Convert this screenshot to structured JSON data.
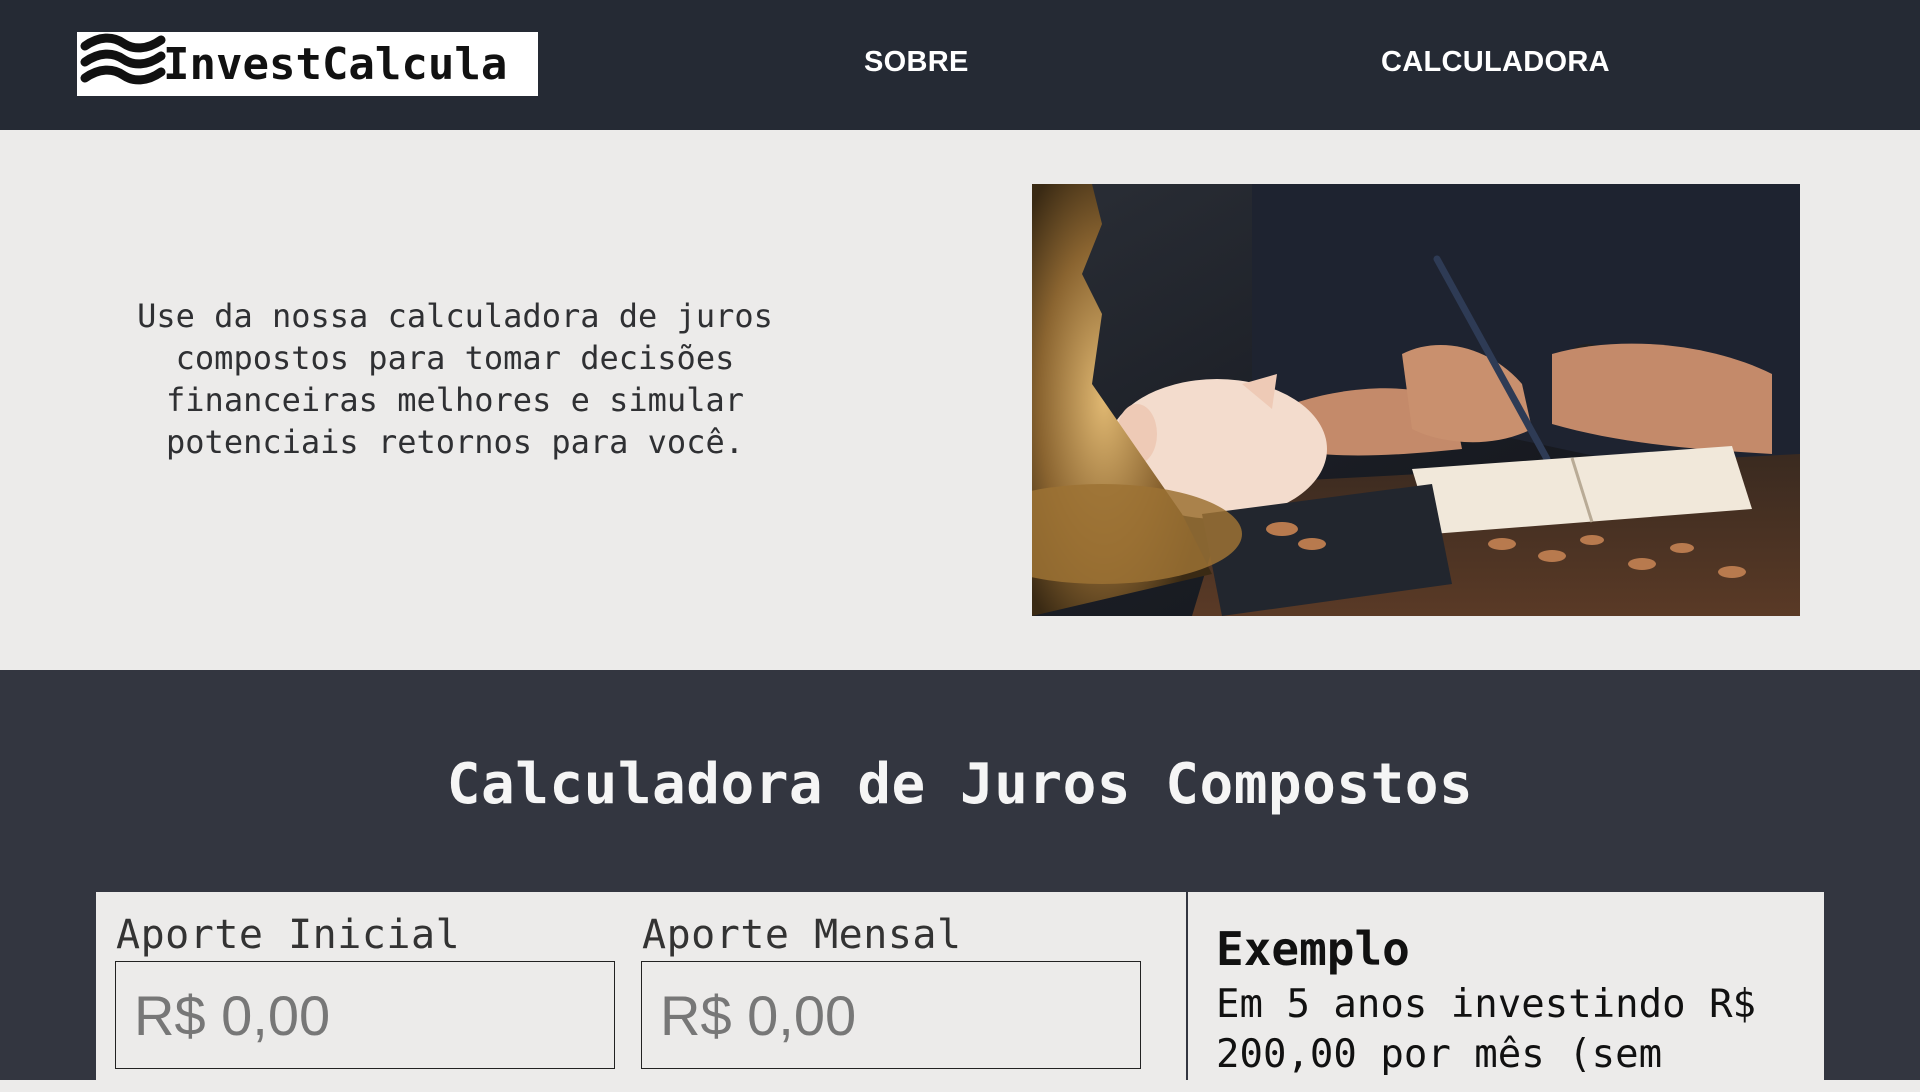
{
  "header": {
    "logo_text": "InvestCalcula",
    "nav": [
      {
        "label": "SOBRE"
      },
      {
        "label": "CALCULADORA"
      }
    ]
  },
  "hero": {
    "description": "Use da nossa calculadora de juros compostos para tomar decisões financeiras melhores e simular potenciais retornos para você.",
    "image_icon": "photo-person-writing-with-piggy-bank-and-coins"
  },
  "calculator": {
    "title": "Calculadora de Juros Compostos",
    "fields": [
      {
        "label": "Aporte Inicial",
        "placeholder": "R$ 0,00"
      },
      {
        "label": "Aporte Mensal",
        "placeholder": "R$ 0,00"
      }
    ],
    "example": {
      "title": "Exemplo",
      "body": "Em 5 anos investindo R$ 200,00 por mês (sem"
    }
  },
  "colors": {
    "header_bg": "#252a34",
    "hero_bg": "#ecebea",
    "calc_bg": "#333640"
  }
}
